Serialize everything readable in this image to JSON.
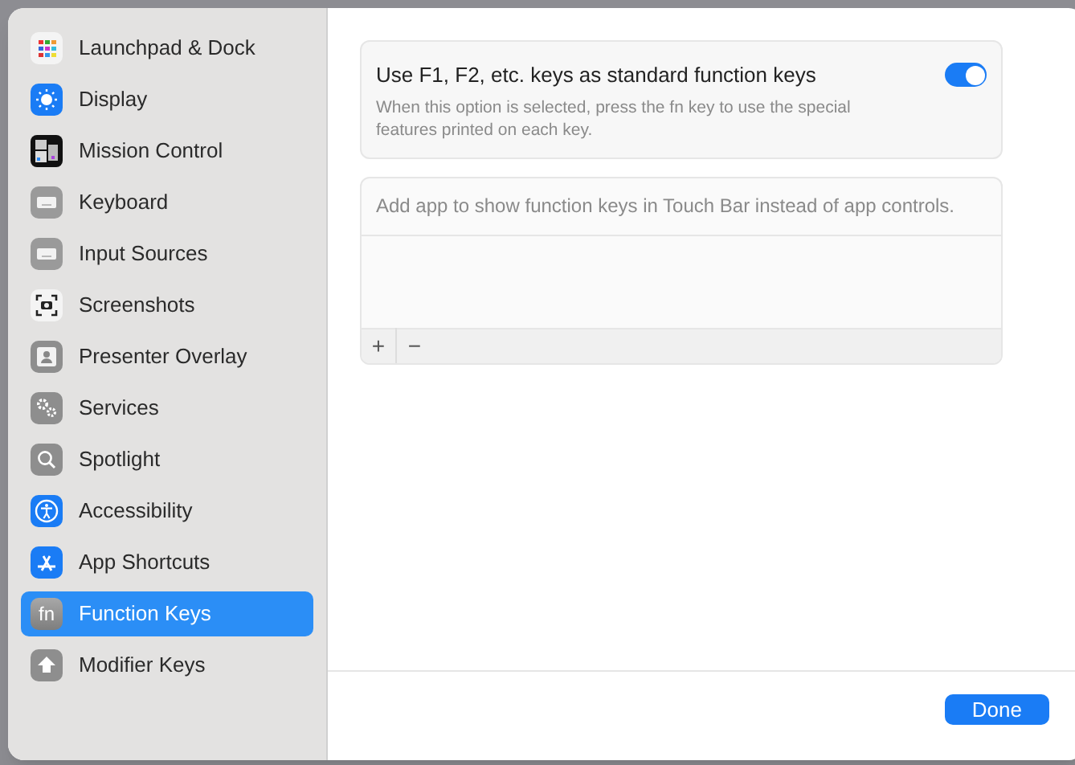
{
  "sidebar": {
    "items": [
      {
        "label": "Launchpad & Dock",
        "selected": false
      },
      {
        "label": "Display",
        "selected": false
      },
      {
        "label": "Mission Control",
        "selected": false
      },
      {
        "label": "Keyboard",
        "selected": false
      },
      {
        "label": "Input Sources",
        "selected": false
      },
      {
        "label": "Screenshots",
        "selected": false
      },
      {
        "label": "Presenter Overlay",
        "selected": false
      },
      {
        "label": "Services",
        "selected": false
      },
      {
        "label": "Spotlight",
        "selected": false
      },
      {
        "label": "Accessibility",
        "selected": false
      },
      {
        "label": "App Shortcuts",
        "selected": false
      },
      {
        "label": "Function Keys",
        "selected": true,
        "icon_text": "fn"
      },
      {
        "label": "Modifier Keys",
        "selected": false
      }
    ]
  },
  "option": {
    "title": "Use F1, F2, etc. keys as standard function keys",
    "description": "When this option is selected, press the fn key to use the special features printed on each key.",
    "on": true
  },
  "app_list": {
    "note": "Add app to show function keys in Touch Bar instead of app controls.",
    "add": "+",
    "remove": "−"
  },
  "footer": {
    "button": "Done"
  }
}
